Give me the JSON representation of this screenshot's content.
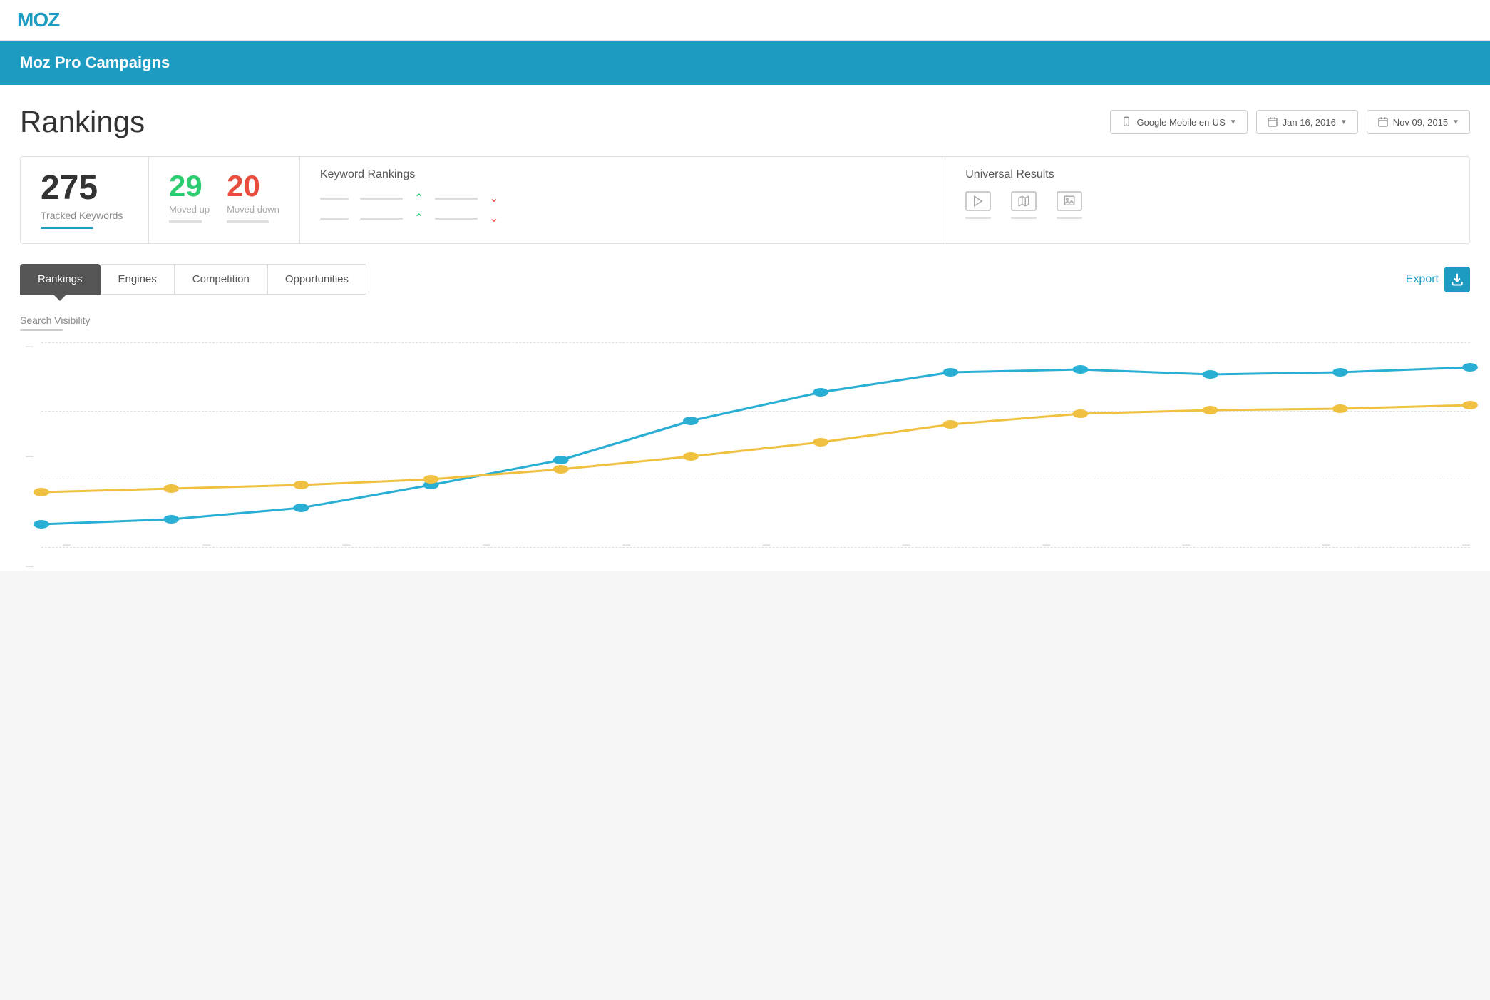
{
  "nav": {
    "logo": "MOZ"
  },
  "campaign": {
    "title": "Moz Pro Campaigns"
  },
  "page": {
    "title": "Rankings"
  },
  "filters": {
    "engine": "Google Mobile en-US",
    "date1": "Jan 16, 2016",
    "date2": "Nov 09, 2015"
  },
  "stats": {
    "tracked": {
      "number": "275",
      "label": "Tracked Keywords"
    },
    "moved_up": {
      "number": "29",
      "label": "Moved up"
    },
    "moved_down": {
      "number": "20",
      "label": "Moved down"
    },
    "keyword_rankings_title": "Keyword Rankings",
    "universal_results_title": "Universal Results"
  },
  "tabs": {
    "rankings": "Rankings",
    "engines": "Engines",
    "competition": "Competition",
    "opportunities": "Opportunities",
    "export": "Export"
  },
  "chart": {
    "section_label": "Search Visibility",
    "y_labels": [
      "—",
      "—",
      "—"
    ],
    "x_labels": [
      "—",
      "—",
      "—",
      "—",
      "—",
      "—",
      "—",
      "—",
      "—",
      "—",
      "—"
    ]
  }
}
